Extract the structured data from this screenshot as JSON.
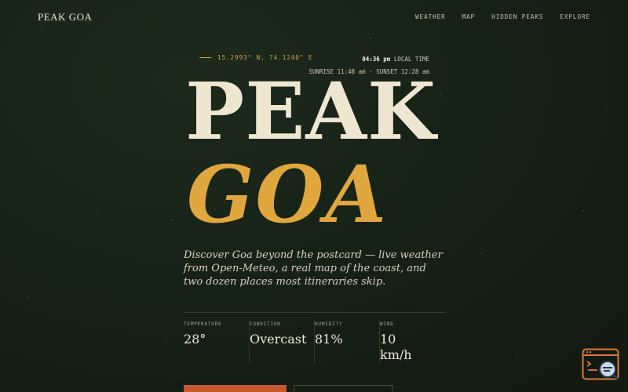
{
  "nav": {
    "brand": "PEAK GOA",
    "links": [
      "WEATHER",
      "MAP",
      "HIDDEN PEAKS",
      "EXPLORE"
    ]
  },
  "location": {
    "coordinates": "15.2993° N, 74.1240° E",
    "time": "04:36 pm",
    "time_suffix": "LOCAL TIME",
    "sun": "SUNRISE 11:48 am · SUNSET 12:28 am"
  },
  "hero": {
    "line1": "PEAK",
    "line2": "GOA",
    "tagline": "Discover Goa beyond the postcard — live weather from Open-Meteo, a real map of the coast, and two dozen places most itineraries skip."
  },
  "stats": [
    {
      "label": "TEMPERATURE",
      "value": "28°"
    },
    {
      "label": "CONDITION",
      "value": "Overcast"
    },
    {
      "label": "HUMIDITY",
      "value": "81%"
    },
    {
      "label": "WIND",
      "value": "10 km/h"
    }
  ],
  "colors": {
    "background": "#172217",
    "accent": "#e0a73e",
    "cream": "#efe6d2",
    "button": "#c65a2a"
  },
  "icons": {
    "widget": "chat-bot-icon"
  }
}
